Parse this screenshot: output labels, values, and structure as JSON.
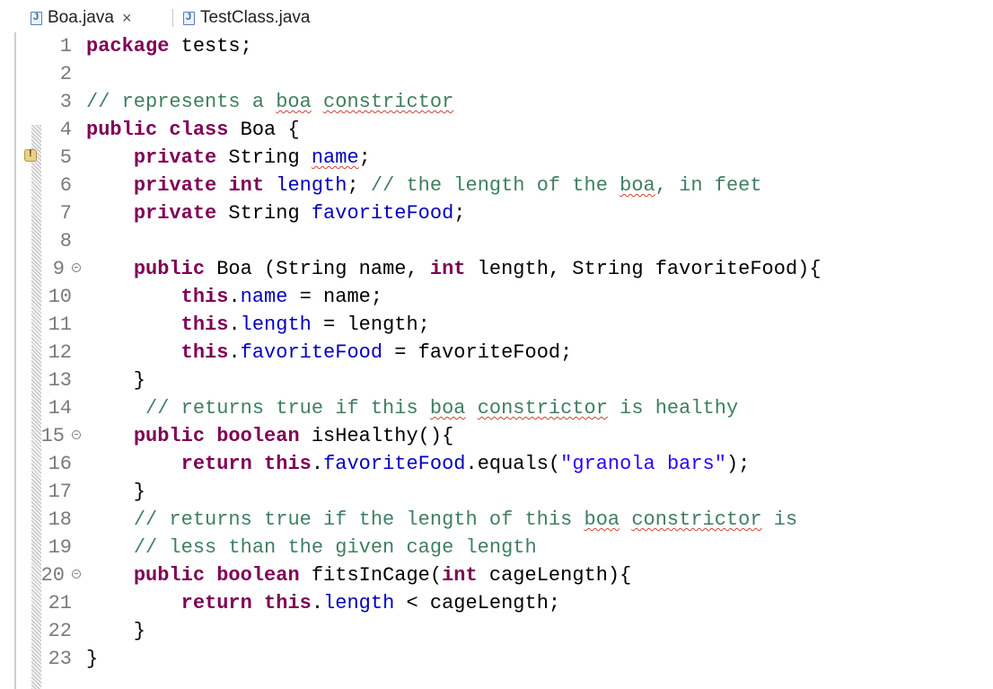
{
  "tabs": [
    {
      "label": "Boa.java",
      "active": true,
      "close": "×"
    },
    {
      "label": "TestClass.java",
      "active": false
    }
  ],
  "editor": {
    "line_numbers": [
      "1",
      "2",
      "3",
      "4",
      "5",
      "6",
      "7",
      "8",
      "9",
      "10",
      "11",
      "12",
      "13",
      "14",
      "15",
      "16",
      "17",
      "18",
      "19",
      "20",
      "21",
      "22",
      "23"
    ],
    "lines": {
      "l1_kw": "package",
      "l1_rest": " tests;",
      "l3_a": "// represents a ",
      "l3_b": "boa",
      "l3_c": " ",
      "l3_d": "constrictor",
      "l4_kw1": "public",
      "l4_sp": " ",
      "l4_kw2": "class",
      "l4_rest": " Boa {",
      "l5_ind": "    ",
      "l5_kw": "private",
      "l5_a": " String ",
      "l5_b": "name",
      "l5_c": ";",
      "l6_ind": "    ",
      "l6_kw1": "private",
      "l6_sp": " ",
      "l6_kw2": "int",
      "l6_sp2": " ",
      "l6_fld": "length",
      "l6_semi": "; ",
      "l6_cm1": "// the length of the ",
      "l6_cm2": "boa",
      "l6_cm3": ", in feet",
      "l7_ind": "    ",
      "l7_kw": "private",
      "l7_rest": " String ",
      "l7_fld": "favoriteFood",
      "l7_semi": ";",
      "l9_ind": "    ",
      "l9_kw1": "public",
      "l9_a": " Boa (String name, ",
      "l9_kw2": "int",
      "l9_b": " length, String favoriteFood){",
      "l10_ind": "        ",
      "l10_kw": "this",
      "l10_dot": ".",
      "l10_fld": "name",
      "l10_rest": " = name;",
      "l11_ind": "        ",
      "l11_kw": "this",
      "l11_dot": ".",
      "l11_fld": "length",
      "l11_rest": " = length;",
      "l12_ind": "        ",
      "l12_kw": "this",
      "l12_dot": ".",
      "l12_fld": "favoriteFood",
      "l12_rest": " = favoriteFood;",
      "l13": "    }",
      "l14_ind": "     ",
      "l14_a": "// returns true if this ",
      "l14_b": "boa",
      "l14_c": " ",
      "l14_d": "constrictor",
      "l14_e": " is healthy",
      "l15_ind": "    ",
      "l15_kw1": "public",
      "l15_sp": " ",
      "l15_kw2": "boolean",
      "l15_rest": " isHealthy(){",
      "l16_ind": "        ",
      "l16_kw1": "return",
      "l16_sp": " ",
      "l16_kw2": "this",
      "l16_dot": ".",
      "l16_fld": "favoriteFood",
      "l16_a": ".equals(",
      "l16_str": "\"granola bars\"",
      "l16_b": ");",
      "l17": "    }",
      "l18_ind": "    ",
      "l18_a": "// returns true if the length of this ",
      "l18_b": "boa",
      "l18_c": " ",
      "l18_d": "constrictor",
      "l18_e": " is",
      "l19_ind": "    ",
      "l19_a": "// less than the given cage length",
      "l20_ind": "    ",
      "l20_kw1": "public",
      "l20_sp": " ",
      "l20_kw2": "boolean",
      "l20_a": " fitsInCage(",
      "l20_kw3": "int",
      "l20_b": " cageLength){",
      "l21_ind": "        ",
      "l21_kw1": "return",
      "l21_sp": " ",
      "l21_kw2": "this",
      "l21_dot": ".",
      "l21_fld": "length",
      "l21_rest": " < cageLength;",
      "l22": "    }",
      "l23": "}"
    }
  }
}
